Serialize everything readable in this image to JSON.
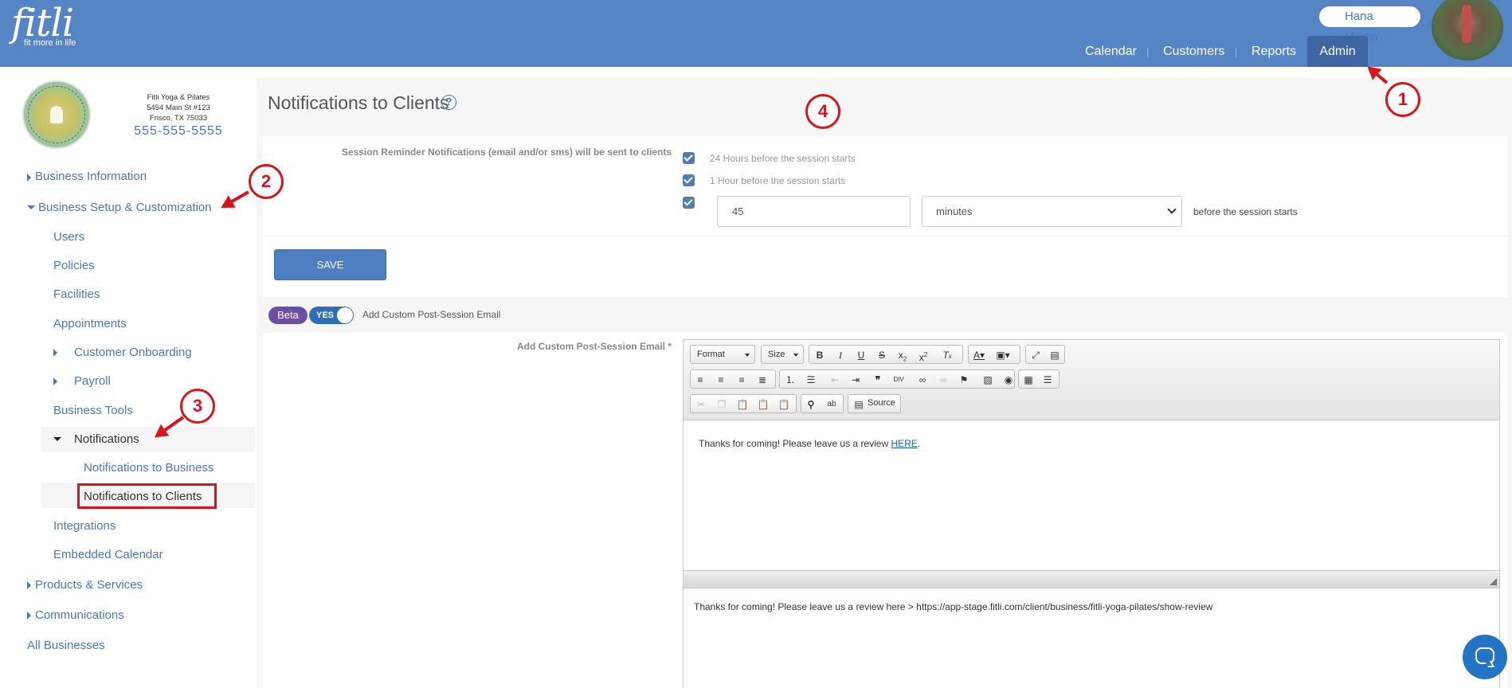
{
  "brand": {
    "name": "fitli",
    "tagline": "fit more in life"
  },
  "header": {
    "user_name": "Hana Martin",
    "nav": [
      {
        "label": "Calendar"
      },
      {
        "label": "Customers"
      },
      {
        "label": "Reports"
      },
      {
        "label": "Admin",
        "active": true
      }
    ]
  },
  "business": {
    "name": "Fitli Yoga & Pilates",
    "street": "5454 Main St #123",
    "city": "Frisco, TX 75033",
    "phone": "555-555-5555"
  },
  "sidebar": {
    "business_information": "Business Information",
    "business_setup": "Business Setup & Customization",
    "users": "Users",
    "policies": "Policies",
    "facilities": "Facilities",
    "appointments": "Appointments",
    "customer_onboarding": "Customer Onboarding",
    "payroll": "Payroll",
    "business_tools": "Business Tools",
    "notifications": "Notifications",
    "notifications_business": "Notifications to Business",
    "notifications_clients": "Notifications to Clients",
    "integrations": "Integrations",
    "embedded_calendar": "Embedded Calendar",
    "products_services": "Products & Services",
    "communications": "Communications",
    "all_businesses": "All Businesses"
  },
  "page": {
    "title": "Notifications to Clients",
    "help_glyph": "?",
    "reminder_label": "Session Reminder Notifications (email and/or sms) will be sent to clients",
    "option_24h": "24 Hours before the session starts",
    "option_1h": "1 Hour before the session starts",
    "custom_value": "45",
    "custom_unit": "minutes",
    "custom_suffix": "before the session starts",
    "save_label": "SAVE",
    "beta_label": "Beta",
    "toggle_label": "YES",
    "toggle_desc": "Add Custom Post-Session Email",
    "email_label": "Add Custom Post-Session Email *"
  },
  "editor": {
    "format_label": "Format",
    "size_label": "Size",
    "source_label": "Source",
    "content_text": "Thanks for coming! Please leave us a review ",
    "content_link": "HERE",
    "content_end": ".",
    "plain_text": "Thanks for coming! Please leave us a review here > https://app-stage.fitli.com/client/business/fitli-yoga-pilates/show-review"
  },
  "annotations": [
    "1",
    "2",
    "3",
    "4"
  ],
  "colors": {
    "header": "#5585c4",
    "accent": "#4a78b8",
    "annotation": "#d8141a",
    "beta": "#6c4fa2"
  }
}
